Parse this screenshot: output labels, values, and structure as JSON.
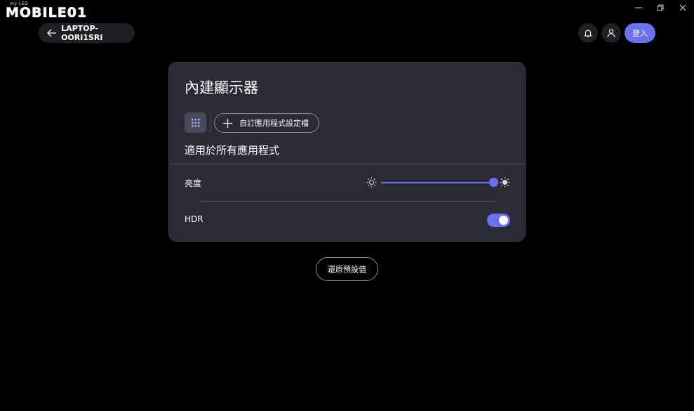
{
  "brand": {
    "small": "my-LED",
    "name": "MOBILE01"
  },
  "window_controls": [
    "minimize",
    "restore",
    "close"
  ],
  "header": {
    "device_name": "LAPTOP-OORI1SRI",
    "login_label": "登入"
  },
  "card": {
    "title": "內建顯示器",
    "add_profile_label": "自訂應用程式設定檔",
    "scope_label": "適用於所有應用程式",
    "brightness": {
      "label": "亮度",
      "value_fraction": 0.98
    },
    "hdr": {
      "label": "HDR",
      "enabled": true
    }
  },
  "reset_label": "還原預設值",
  "colors": {
    "accent": "#6a72f0",
    "card": "#2b2b37",
    "background": "#000000"
  },
  "icons": [
    "back-arrow-icon",
    "bell-icon",
    "user-icon",
    "grid-icon",
    "plus-icon",
    "sun-low-icon",
    "sun-high-icon"
  ]
}
